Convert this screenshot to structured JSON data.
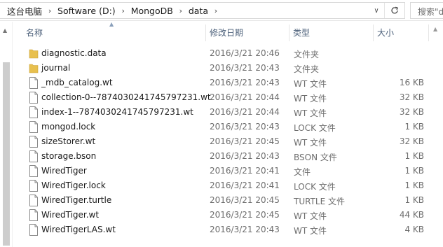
{
  "address_bar": {
    "crumbs": [
      "这台电脑",
      "Software (D:)",
      "MongoDB",
      "data"
    ],
    "search_placeholder": "搜索\"data\""
  },
  "columns": {
    "name": "名称",
    "date": "修改日期",
    "type": "类型",
    "size": "大小"
  },
  "files": [
    {
      "name": "diagnostic.data",
      "date": "2016/3/21 20:46",
      "type": "文件夹",
      "size": "",
      "icon": "folder-icon"
    },
    {
      "name": "journal",
      "date": "2016/3/21 20:43",
      "type": "文件夹",
      "size": "",
      "icon": "folder-icon"
    },
    {
      "name": "_mdb_catalog.wt",
      "date": "2016/3/21 20:43",
      "type": "WT 文件",
      "size": "16 KB",
      "icon": "file-icon"
    },
    {
      "name": "collection-0--7874030241745797231.wt",
      "date": "2016/3/21 20:44",
      "type": "WT 文件",
      "size": "32 KB",
      "icon": "file-icon"
    },
    {
      "name": "index-1--7874030241745797231.wt",
      "date": "2016/3/21 20:44",
      "type": "WT 文件",
      "size": "32 KB",
      "icon": "file-icon"
    },
    {
      "name": "mongod.lock",
      "date": "2016/3/21 20:43",
      "type": "LOCK 文件",
      "size": "1 KB",
      "icon": "file-icon"
    },
    {
      "name": "sizeStorer.wt",
      "date": "2016/3/21 20:45",
      "type": "WT 文件",
      "size": "32 KB",
      "icon": "file-icon"
    },
    {
      "name": "storage.bson",
      "date": "2016/3/21 20:43",
      "type": "BSON 文件",
      "size": "1 KB",
      "icon": "file-icon"
    },
    {
      "name": "WiredTiger",
      "date": "2016/3/21 20:41",
      "type": "文件",
      "size": "1 KB",
      "icon": "file-icon"
    },
    {
      "name": "WiredTiger.lock",
      "date": "2016/3/21 20:41",
      "type": "LOCK 文件",
      "size": "1 KB",
      "icon": "file-icon"
    },
    {
      "name": "WiredTiger.turtle",
      "date": "2016/3/21 20:45",
      "type": "TURTLE 文件",
      "size": "1 KB",
      "icon": "file-icon"
    },
    {
      "name": "WiredTiger.wt",
      "date": "2016/3/21 20:45",
      "type": "WT 文件",
      "size": "44 KB",
      "icon": "file-icon"
    },
    {
      "name": "WiredTigerLAS.wt",
      "date": "2016/3/21 20:43",
      "type": "WT 文件",
      "size": "4 KB",
      "icon": "file-icon"
    }
  ],
  "colors": {
    "folder": "#e8c04e",
    "header_text": "#4c607a",
    "muted_text": "#6d6d6d"
  }
}
